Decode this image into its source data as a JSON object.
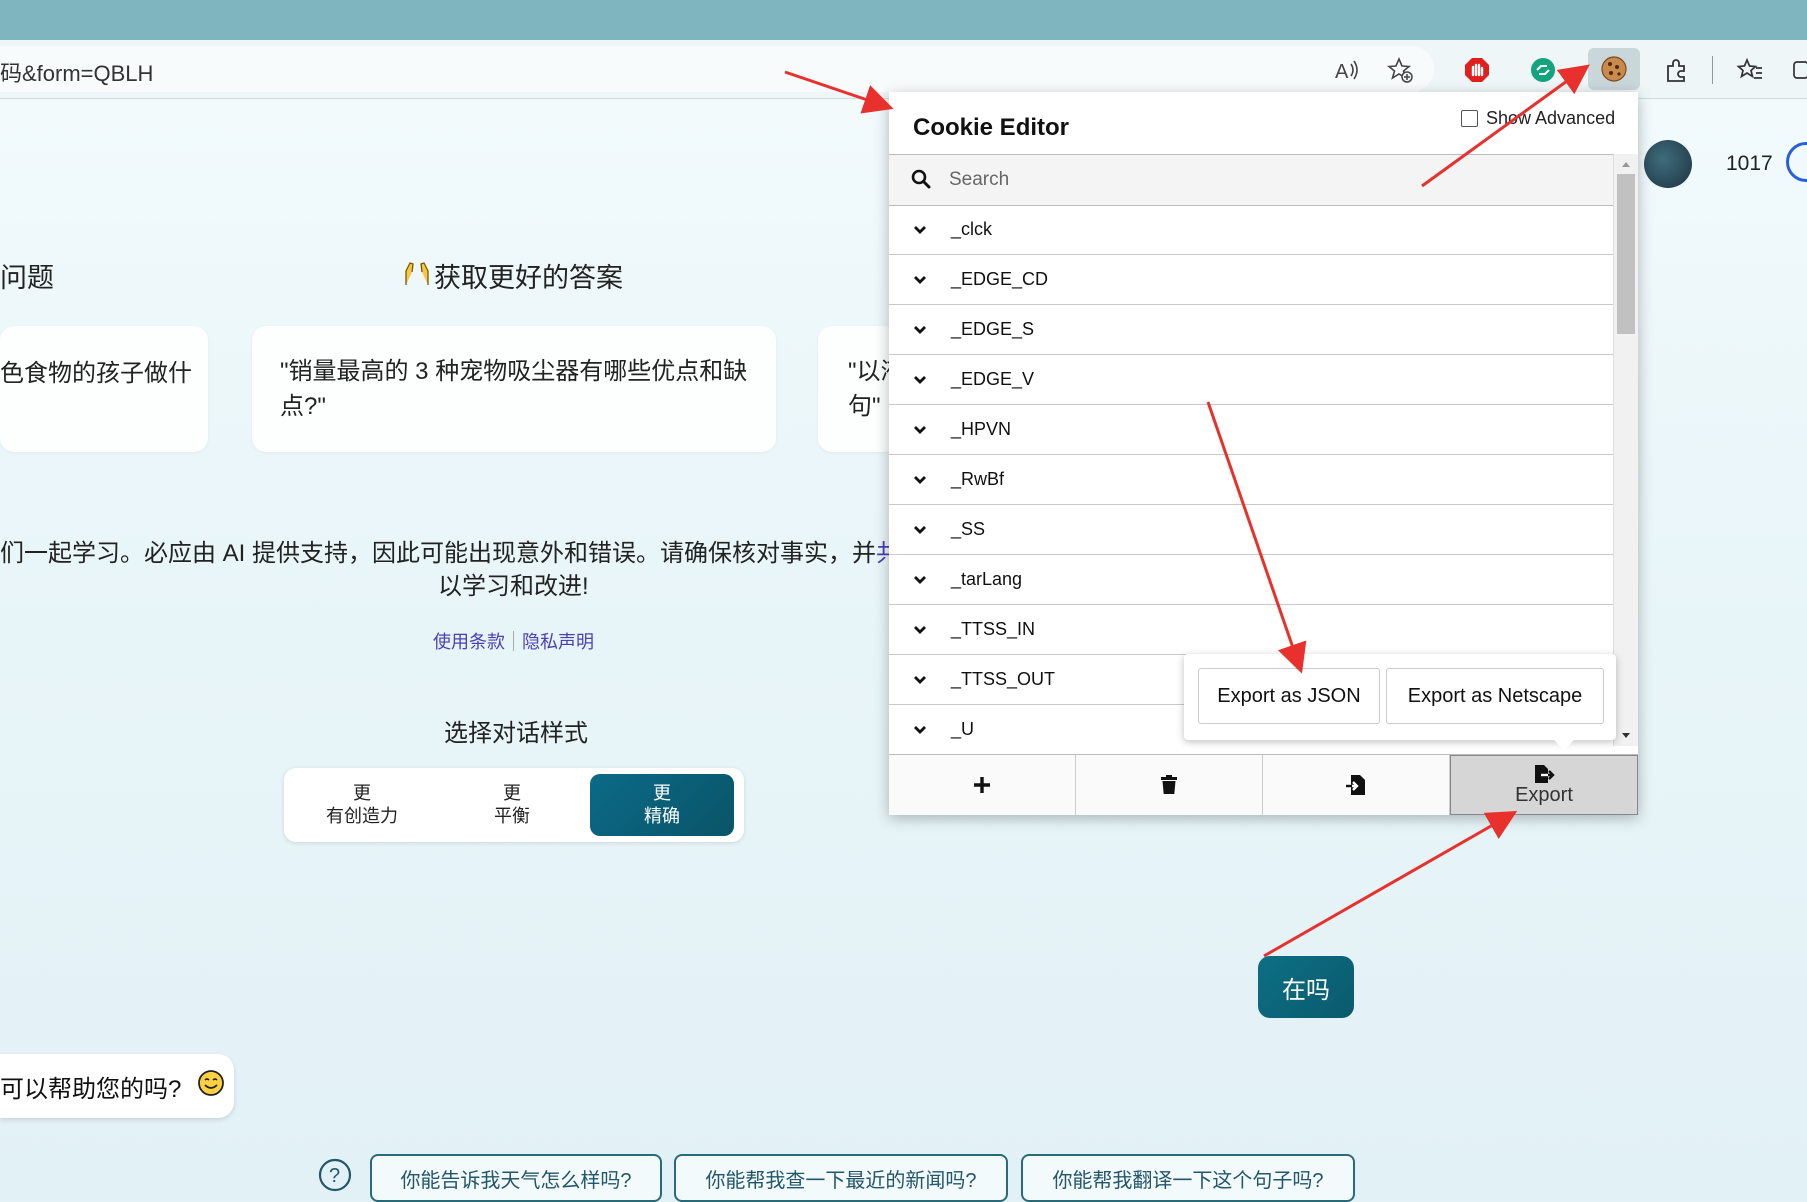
{
  "browser": {
    "url": "码&form=QBLH",
    "read_aloud_icon": "read-aloud-icon",
    "favorite_icon": "add-favorite-icon",
    "extensions": [
      "adblock-icon",
      "grammarly-icon",
      "cookie-editor-icon",
      "extensions-puzzle-icon",
      "favorites-icon"
    ]
  },
  "page": {
    "heading_left": "问题",
    "heading_right": "获取更好的答案",
    "card_left_text": "色食物的孩子做什",
    "card_middle_text": "\"销量最高的 3 种宠物吸尘器有哪些优点和缺点?\"",
    "card_right_line1": "\"以液",
    "card_right_line2": "句\"",
    "disclaimer_line1": "们一起学习。必应由 AI 提供支持，因此可能出现意外和错误。请确保核对事实，并",
    "disclaimer_link": "共",
    "disclaimer_line2": "以学习和改进!",
    "terms_link": "使用条款",
    "privacy_link": "隐私声明",
    "tone_title": "选择对话样式",
    "tones": [
      {
        "line1": "更",
        "line2": "有创造力"
      },
      {
        "line1": "更",
        "line2": "平衡"
      },
      {
        "line1": "更",
        "line2": "精确"
      }
    ],
    "user_count": "1017",
    "bot_message": "可以帮助您的吗?",
    "user_message": "在吗",
    "suggestions": [
      "你能告诉我天气怎么样吗?",
      "你能帮我查一下最近的新闻吗?",
      "你能帮我翻译一下这个句子吗?"
    ]
  },
  "cookie_editor": {
    "title": "Cookie Editor",
    "show_advanced_label": "Show Advanced",
    "search_placeholder": "Search",
    "cookies": [
      "_clck",
      "_EDGE_CD",
      "_EDGE_S",
      "_EDGE_V",
      "_HPVN",
      "_RwBf",
      "_SS",
      "_tarLang",
      "_TTSS_IN",
      "_TTSS_OUT",
      "_U"
    ],
    "export_label": "Export",
    "export_json": "Export as JSON",
    "export_netscape": "Export as Netscape"
  },
  "colors": {
    "accent": "#0a5a6c",
    "arrow": "#e8302c"
  }
}
